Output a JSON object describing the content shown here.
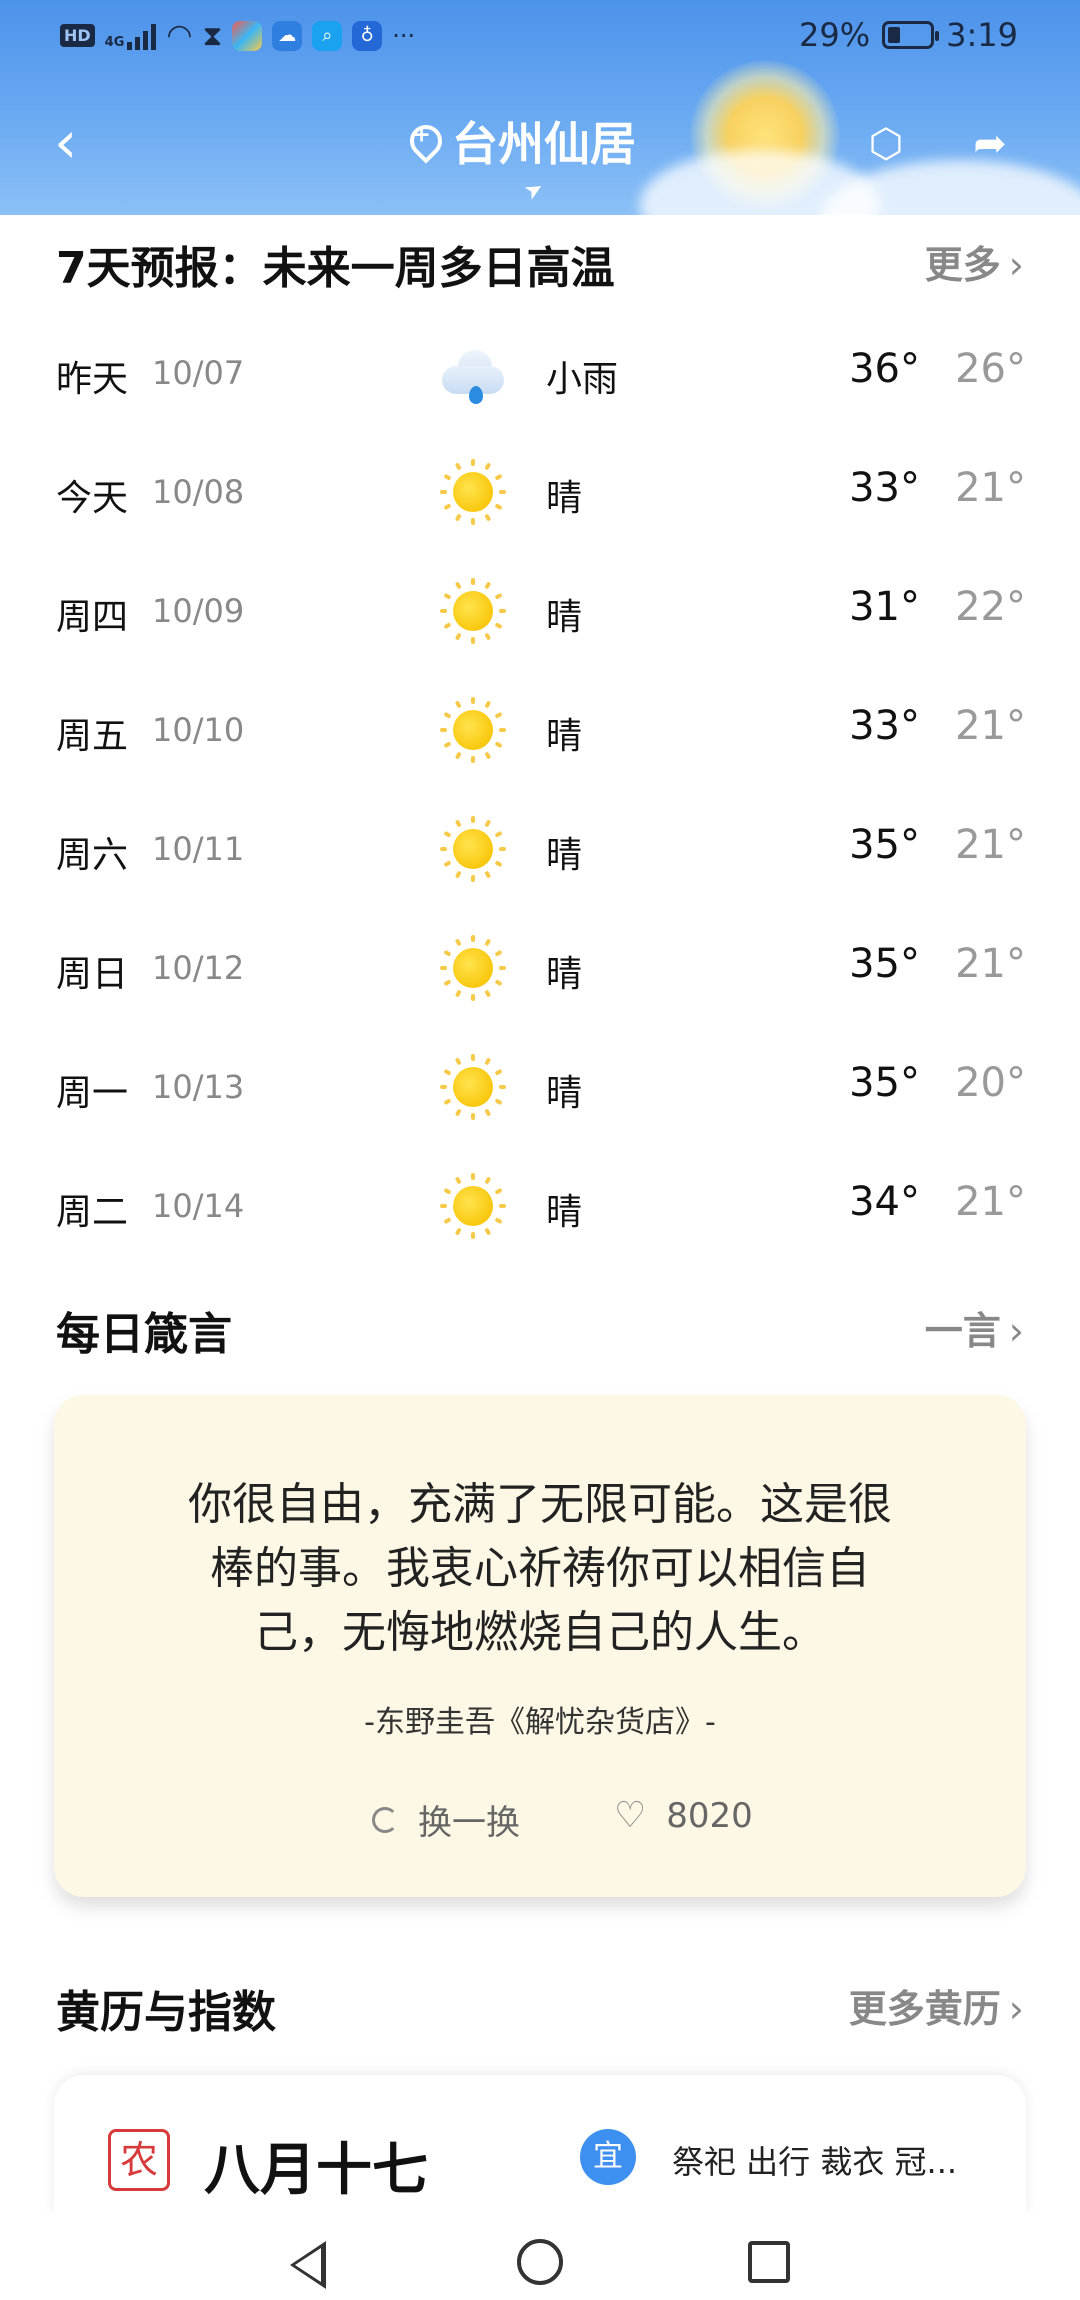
{
  "status_bar": {
    "network_badge": "HD",
    "network_type": "4G",
    "battery_percent": "29%",
    "battery_level": 0.29,
    "time": "3:19",
    "more_indicator": "···"
  },
  "header": {
    "city": "台州仙居",
    "icons": [
      "back-icon",
      "location-pin-icon",
      "lightning-hexagon-icon",
      "share-icon"
    ]
  },
  "forecast": {
    "title": "7天预报：未来一周多日高温",
    "more_label": "更多",
    "days": [
      {
        "day": "昨天",
        "date": "10/07",
        "icon": "rain-icon",
        "condition": "小雨",
        "high": "36°",
        "low": "26°"
      },
      {
        "day": "今天",
        "date": "10/08",
        "icon": "sun-icon",
        "condition": "晴",
        "high": "33°",
        "low": "21°"
      },
      {
        "day": "周四",
        "date": "10/09",
        "icon": "sun-icon",
        "condition": "晴",
        "high": "31°",
        "low": "22°"
      },
      {
        "day": "周五",
        "date": "10/10",
        "icon": "sun-icon",
        "condition": "晴",
        "high": "33°",
        "low": "21°"
      },
      {
        "day": "周六",
        "date": "10/11",
        "icon": "sun-icon",
        "condition": "晴",
        "high": "35°",
        "low": "21°"
      },
      {
        "day": "周日",
        "date": "10/12",
        "icon": "sun-icon",
        "condition": "晴",
        "high": "35°",
        "low": "21°"
      },
      {
        "day": "周一",
        "date": "10/13",
        "icon": "sun-icon",
        "condition": "晴",
        "high": "35°",
        "low": "20°"
      },
      {
        "day": "周二",
        "date": "10/14",
        "icon": "sun-icon",
        "condition": "晴",
        "high": "34°",
        "low": "21°"
      }
    ]
  },
  "quote": {
    "title": "每日箴言",
    "more_label": "一言",
    "lines": [
      "你很自由，充满了无限可能。这是很",
      "棒的事。我衷心祈祷你可以相信自",
      "己，无悔地燃烧自己的人生。"
    ],
    "source": "-东野圭吾《解忧杂货店》-",
    "refresh_label": "换一换",
    "like_count": "8020"
  },
  "almanac": {
    "title": "黄历与指数",
    "more_label": "更多黄历",
    "nong_badge": "农",
    "lunar_date": "八月十七",
    "yi_badge": "宜",
    "yi_text": "祭祀 出行 裁衣 冠..."
  },
  "colors": {
    "header_blue": "#4c92ea",
    "quote_bg": "#fdf8e5",
    "sun_yellow": "#f9c80e",
    "yi_blue": "#3d8ff0",
    "nong_red": "#d63a3a"
  }
}
